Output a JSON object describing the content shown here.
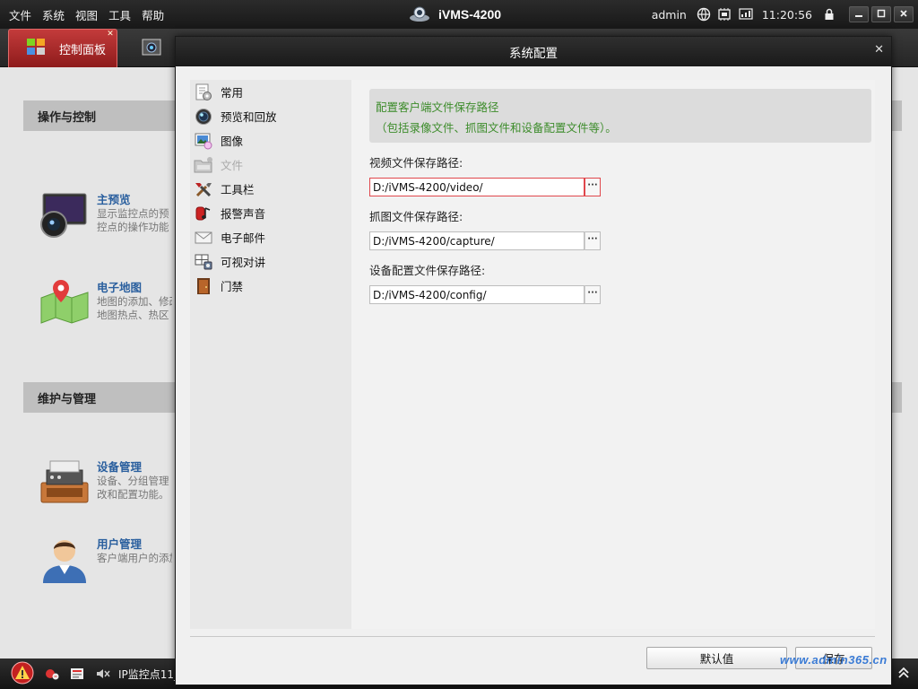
{
  "app": {
    "title": "iVMS-4200",
    "menu": [
      "文件",
      "系统",
      "视图",
      "工具",
      "帮助"
    ],
    "user": "admin",
    "time": "11:20:56",
    "tray_icons": [
      "network-globe-icon",
      "cpu-icon",
      "ram-icon"
    ]
  },
  "tabs": [
    {
      "label": "控制面板",
      "active": true
    }
  ],
  "control_panel": {
    "sections": [
      {
        "title": "操作与控制",
        "modules": [
          {
            "title": "主预览",
            "desc": [
              "显示监控点的预",
              "控点的操作功能"
            ]
          },
          {
            "title": "电子地图",
            "desc": [
              "地图的添加、修改",
              "地图热点、热区"
            ]
          }
        ]
      },
      {
        "title": "维护与管理",
        "modules": [
          {
            "title": "设备管理",
            "desc": [
              "设备、分组管理",
              "改和配置功能。"
            ]
          },
          {
            "title": "用户管理",
            "desc": [
              "客户端用户的添加"
            ]
          }
        ]
      }
    ]
  },
  "status_bar": {
    "camera_label": "IP监控点11_"
  },
  "dialog": {
    "title": "系统配置",
    "nav": [
      {
        "label": "常用",
        "icon": "settings-page-icon",
        "enabled": true
      },
      {
        "label": "预览和回放",
        "icon": "camera-lens-icon",
        "enabled": true
      },
      {
        "label": "图像",
        "icon": "image-icon",
        "enabled": true
      },
      {
        "label": "文件",
        "icon": "folder-icon",
        "enabled": false
      },
      {
        "label": "工具栏",
        "icon": "tools-icon",
        "enabled": true
      },
      {
        "label": "报警声音",
        "icon": "alarm-sound-icon",
        "enabled": true
      },
      {
        "label": "电子邮件",
        "icon": "email-icon",
        "enabled": true
      },
      {
        "label": "可视对讲",
        "icon": "intercom-icon",
        "enabled": true
      },
      {
        "label": "门禁",
        "icon": "door-icon",
        "enabled": true
      }
    ],
    "hint_line1": "配置客户端文件保存路径",
    "hint_line2": "（包括录像文件、抓图文件和设备配置文件等）。",
    "fields": {
      "video": {
        "label": "视频文件保存路径:",
        "value": "D:/iVMS-4200/video/"
      },
      "capture": {
        "label": "抓图文件保存路径:",
        "value": "D:/iVMS-4200/capture/"
      },
      "config": {
        "label": "设备配置文件保存路径:",
        "value": "D:/iVMS-4200/config/"
      }
    },
    "browse_label": "···",
    "default_button": "默认值",
    "save_button": "保存"
  },
  "watermark": "www.admin365.cn",
  "colors": {
    "accent_red": "#c33b3b",
    "hint_green": "#3d8c2b",
    "module_title_blue": "#2a5f9e"
  }
}
